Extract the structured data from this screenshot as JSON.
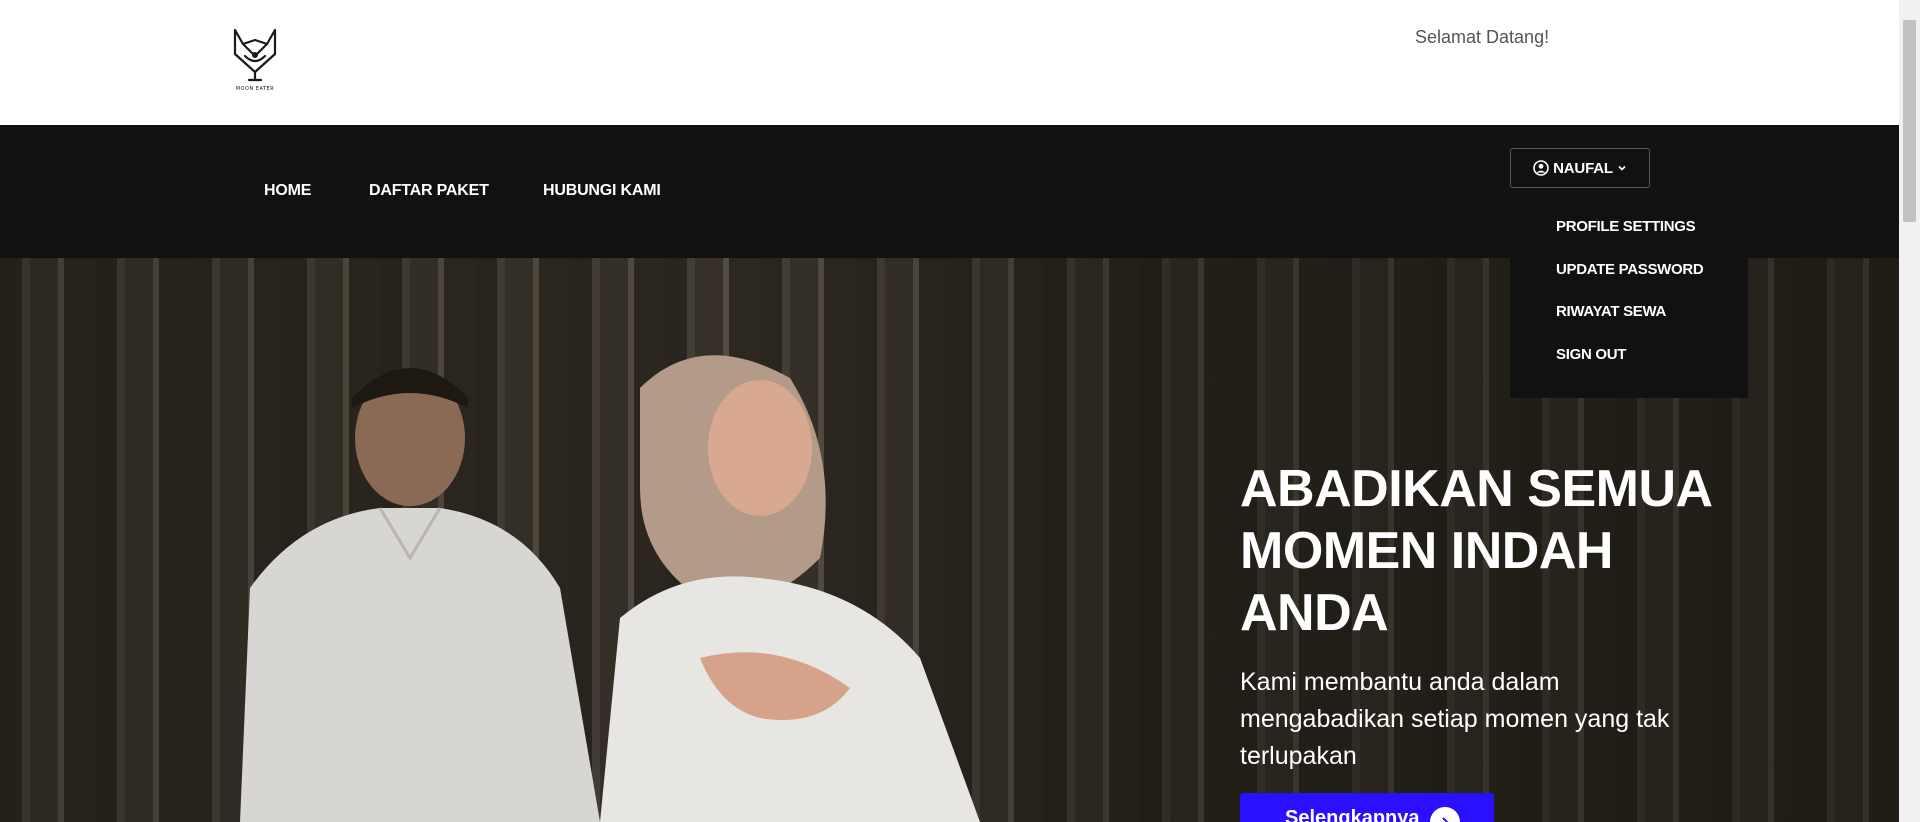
{
  "header": {
    "logo_alt": "MOON EATER",
    "logo_sub": "studio",
    "welcome": "Selamat Datang!"
  },
  "nav": {
    "items": [
      {
        "label": "HOME"
      },
      {
        "label": "DAFTAR PAKET"
      },
      {
        "label": "HUBUNGI KAMI"
      }
    ],
    "user_label": "NAUFAL",
    "user_icon": "user-circle-icon",
    "chevron_icon": "chevron-down-icon"
  },
  "dropdown": {
    "items": [
      {
        "label": "PROFILE SETTINGS"
      },
      {
        "label": "UPDATE PASSWORD"
      },
      {
        "label": "RIWAYAT SEWA"
      },
      {
        "label": "SIGN OUT"
      }
    ]
  },
  "hero": {
    "title": "ABADIKAN SEMUA MOMEN INDAH ANDA",
    "subtitle": "Kami membantu anda dalam mengabadikan setiap momen yang tak terlupakan",
    "button_label": "Selengkapnya",
    "button_icon": "arrow-right-circle-icon"
  },
  "colors": {
    "navbar_bg": "#111111",
    "accent_button": "#2a10ff",
    "welcome_text": "#555555"
  }
}
